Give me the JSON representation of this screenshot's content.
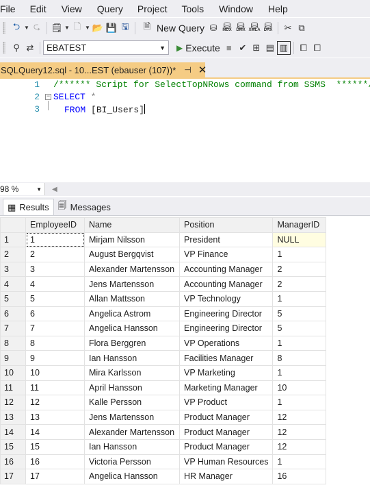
{
  "menu": [
    "File",
    "Edit",
    "View",
    "Query",
    "Project",
    "Tools",
    "Window",
    "Help"
  ],
  "toolbar1": {
    "new_query_label": "New Query",
    "small_icons": [
      "MDX",
      "DMX",
      "XMLA",
      "DAX"
    ]
  },
  "toolbar2": {
    "database": "EBATEST",
    "execute_label": "Execute"
  },
  "doc_tab": {
    "title": "SQLQuery12.sql - 10...EST (ebauser (107))*",
    "pin": "⊣",
    "close": "✕"
  },
  "editor": {
    "line_numbers": [
      "1",
      "2",
      "3"
    ],
    "line1": "/****** Script for SelectTopNRows command from SSMS  ******/",
    "line2_kw": "SELECT",
    "line2_rest": " *",
    "line3_kw": "FROM",
    "line3_rest": " [BI_Users]"
  },
  "zoom": "98 %",
  "results_tabs": {
    "results": "Results",
    "messages": "Messages"
  },
  "grid": {
    "columns": [
      "EmployeeID",
      "Name",
      "Position",
      "ManagerID"
    ],
    "rows": [
      [
        "1",
        "1",
        "Mirjam Nilsson",
        "President",
        "NULL"
      ],
      [
        "2",
        "2",
        "August Bergqvist",
        "VP Finance",
        "1"
      ],
      [
        "3",
        "3",
        "Alexander Martensson",
        "Accounting Manager",
        "2"
      ],
      [
        "4",
        "4",
        "Jens Martensson",
        "Accounting Manager",
        "2"
      ],
      [
        "5",
        "5",
        "Allan Mattsson",
        "VP Technology",
        "1"
      ],
      [
        "6",
        "6",
        "Angelica Astrom",
        "Engineering Director",
        "5"
      ],
      [
        "7",
        "7",
        "Angelica Hansson",
        "Engineering Director",
        "5"
      ],
      [
        "8",
        "8",
        "Flora Berggren",
        "VP Operations",
        "1"
      ],
      [
        "9",
        "9",
        "Ian Hansson",
        "Facilities Manager",
        "8"
      ],
      [
        "10",
        "10",
        "Mira Karlsson",
        "VP Marketing",
        "1"
      ],
      [
        "11",
        "11",
        "April Hansson",
        "Marketing Manager",
        "10"
      ],
      [
        "12",
        "12",
        "Kalle Persson",
        "VP Product",
        "1"
      ],
      [
        "13",
        "13",
        "Jens Martensson",
        "Product Manager",
        "12"
      ],
      [
        "14",
        "14",
        "Alexander Martensson",
        "Product Manager",
        "12"
      ],
      [
        "15",
        "15",
        "Ian Hansson",
        "Product Manager",
        "12"
      ],
      [
        "16",
        "16",
        "Victoria Persson",
        "VP Human Resources",
        "1"
      ],
      [
        "17",
        "17",
        "Angelica Hansson",
        "HR Manager",
        "16"
      ]
    ]
  },
  "colors": {
    "chrome": "#eeeef2",
    "tab_accent": "#f5cc84",
    "keyword": "#0000ff",
    "comment": "#008000",
    "line_number": "#2b91af"
  }
}
